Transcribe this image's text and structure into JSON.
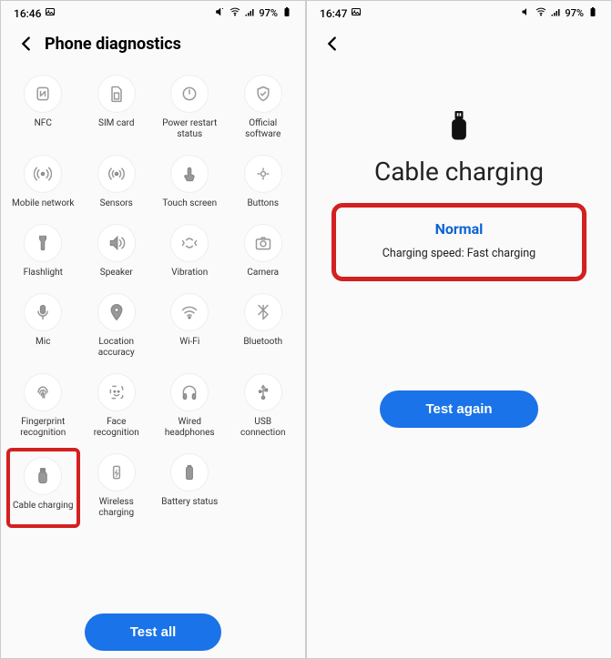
{
  "left": {
    "status": {
      "time": "16:46",
      "battery": "97%"
    },
    "title": "Phone diagnostics",
    "items": [
      {
        "label": "NFC",
        "icon": "nfc",
        "name": "nfc"
      },
      {
        "label": "SIM card",
        "icon": "sim",
        "name": "sim-card"
      },
      {
        "label": "Power restart status",
        "icon": "power",
        "name": "power-restart-status"
      },
      {
        "label": "Official software",
        "icon": "shield",
        "name": "official-software"
      },
      {
        "label": "Mobile network",
        "icon": "antenna",
        "name": "mobile-network"
      },
      {
        "label": "Sensors",
        "icon": "sensors",
        "name": "sensors"
      },
      {
        "label": "Touch screen",
        "icon": "touch",
        "name": "touch-screen"
      },
      {
        "label": "Buttons",
        "icon": "buttons",
        "name": "buttons"
      },
      {
        "label": "Flashlight",
        "icon": "flashlight",
        "name": "flashlight"
      },
      {
        "label": "Speaker",
        "icon": "speaker",
        "name": "speaker"
      },
      {
        "label": "Vibration",
        "icon": "vibration",
        "name": "vibration"
      },
      {
        "label": "Camera",
        "icon": "camera",
        "name": "camera"
      },
      {
        "label": "Mic",
        "icon": "mic",
        "name": "mic"
      },
      {
        "label": "Location accuracy",
        "icon": "location",
        "name": "location-accuracy"
      },
      {
        "label": "Wi-Fi",
        "icon": "wifi",
        "name": "wifi"
      },
      {
        "label": "Bluetooth",
        "icon": "bluetooth",
        "name": "bluetooth"
      },
      {
        "label": "Fingerprint recognition",
        "icon": "fingerprint",
        "name": "fingerprint-recognition"
      },
      {
        "label": "Face recognition",
        "icon": "face",
        "name": "face-recognition"
      },
      {
        "label": "Wired headphones",
        "icon": "headphones",
        "name": "wired-headphones"
      },
      {
        "label": "USB connection",
        "icon": "usb",
        "name": "usb-connection"
      },
      {
        "label": "Cable charging",
        "icon": "cable",
        "name": "cable-charging",
        "highlight": true
      },
      {
        "label": "Wireless charging",
        "icon": "wireless-charge",
        "name": "wireless-charging"
      },
      {
        "label": "Battery status",
        "icon": "battery",
        "name": "battery-status"
      }
    ],
    "test_all": "Test all"
  },
  "right": {
    "status": {
      "time": "16:47",
      "battery": "97%"
    },
    "title": "Cable charging",
    "result_status": "Normal",
    "speed_label": "Charging speed: Fast charging",
    "test_again": "Test again"
  }
}
